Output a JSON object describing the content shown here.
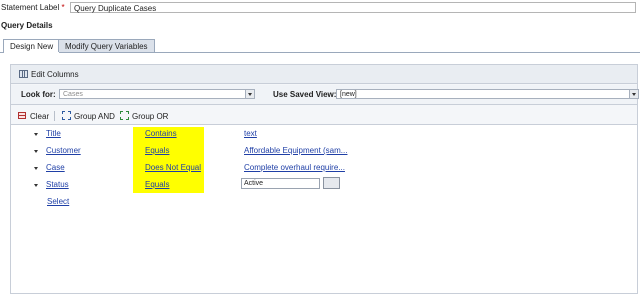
{
  "statement": {
    "label": "Statement Label",
    "required_mark": "*",
    "value": "Query Duplicate Cases"
  },
  "section_title": "Query Details",
  "tabs": [
    {
      "label": "Design New"
    },
    {
      "label": "Modify Query Variables"
    }
  ],
  "toolbar": {
    "edit_columns": "Edit Columns"
  },
  "lookfor": {
    "label": "Look for:",
    "value": "Cases",
    "saved_view_label": "Use Saved View:",
    "saved_view_value": "[new]"
  },
  "actions": {
    "clear": "Clear",
    "group_and": "Group AND",
    "group_or": "Group OR"
  },
  "rows": [
    {
      "field": "Title",
      "operator": "Contains",
      "value": "text"
    },
    {
      "field": "Customer",
      "operator": "Equals",
      "value": "Affordable Equipment (sam..."
    },
    {
      "field": "Case",
      "operator": "Does Not Equal",
      "value": "Complete overhaul require..."
    },
    {
      "field": "Status",
      "operator": "Equals",
      "value": "Active"
    }
  ],
  "select_link": "Select",
  "colors": {
    "highlight": "#ffff00",
    "link": "#1f3fa6",
    "tab_border": "#9aa8bb"
  }
}
